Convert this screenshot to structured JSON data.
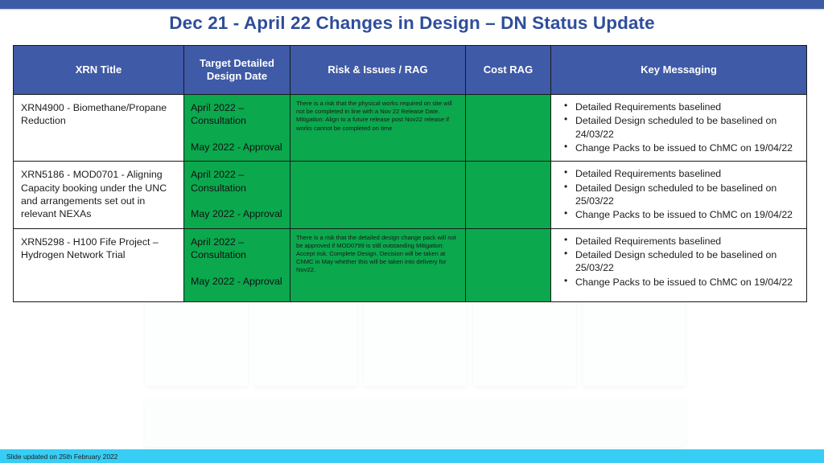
{
  "slide": {
    "title": "Dec 21 - April 22 Changes in Design – DN Status Update",
    "title_color": "#2e4d9b",
    "top_band_color": "#3b5ba5",
    "footer_text": "Slide updated on 25th February 2022",
    "footer_band_color": "#37cdf4"
  },
  "table": {
    "header_bg": "#3f5aa6",
    "rag_green": "#0ba84e",
    "headers": [
      "XRN Title",
      "Target Detailed Design Date",
      "Risk & Issues / RAG",
      "Cost RAG",
      "Key Messaging"
    ],
    "rows": [
      {
        "xrn_title": "XRN4900 - Biomethane/Propane Reduction",
        "target_date_line1": "April 2022 – Consultation",
        "target_date_line2": "May 2022 - Approval",
        "risk_text": "There is a risk that the physical works required on site will not be completed in line with a Nov 22 Release Date. Mitigation: Align to a future release post Nov22 release if works cannot be completed on time",
        "risk_rag": "green",
        "cost_rag": "green",
        "key_messaging": [
          "Detailed Requirements baselined",
          "Detailed Design scheduled to be baselined on 24/03/22",
          "Change Packs to be issued to ChMC on 19/04/22"
        ]
      },
      {
        "xrn_title": "XRN5186 - MOD0701 - Aligning Capacity booking under the UNC and arrangements set out in relevant NEXAs",
        "target_date_line1": "April 2022 – Consultation",
        "target_date_line2": "May 2022 - Approval",
        "risk_text": "",
        "risk_rag": "green",
        "cost_rag": "green",
        "key_messaging": [
          "Detailed Requirements baselined",
          "Detailed Design scheduled to be baselined on 25/03/22",
          "Change Packs to be issued to ChMC on 19/04/22"
        ]
      },
      {
        "xrn_title": "XRN5298 - H100 Fife Project – Hydrogen Network Trial",
        "target_date_line1": "April 2022 – Consultation",
        "target_date_line2": "May 2022 - Approval",
        "risk_text": "There is a risk that the detailed design change pack will not be approved if MOD0799 is still outstanding Mitigation: Accept risk. Complete Design. Decision will be taken at ChMC in May whether this will be taken into delivery for Nov22.",
        "risk_rag": "green",
        "cost_rag": "green",
        "key_messaging": [
          "Detailed Requirements baselined",
          "Detailed Design scheduled to be baselined on 25/03/22",
          "Change Packs to be issued to ChMC on 19/04/22"
        ]
      }
    ]
  }
}
